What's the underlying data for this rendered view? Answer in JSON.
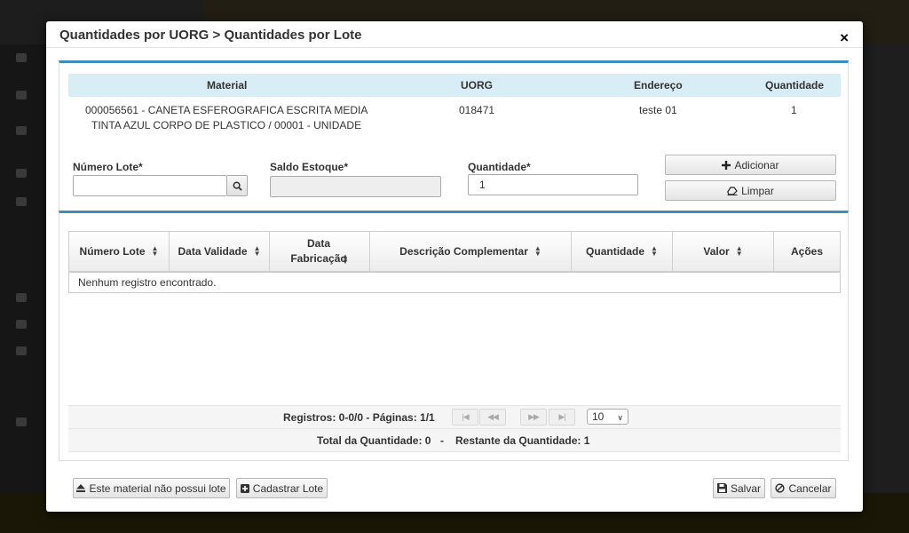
{
  "modal": {
    "title": "Quantidades por UORG > Quantidades por Lote",
    "close_label": "×"
  },
  "material_table": {
    "headers": [
      "Material",
      "UORG",
      "Endereço",
      "Quantidade"
    ],
    "row": {
      "material_line1": "000056561 - CANETA ESFEROGRAFICA ESCRITA MEDIA",
      "material_line2": "TINTA AZUL CORPO DE PLASTICO / 00001 - UNIDADE",
      "uorg": "018471",
      "endereco": "teste 01",
      "quantidade": "1"
    }
  },
  "form": {
    "numero_lote_label": "Número Lote*",
    "numero_lote_value": "",
    "saldo_estoque_label": "Saldo Estoque*",
    "saldo_estoque_value": "",
    "quantidade_label": "Quantidade*",
    "quantidade_value": "1",
    "adicionar_label": "Adicionar",
    "limpar_label": "Limpar"
  },
  "lotes_table": {
    "headers": [
      "Número Lote",
      "Data Validade",
      "Data Fabricação",
      "Descrição Complementar",
      "Quantidade",
      "Valor",
      "Ações"
    ],
    "empty_message": "Nenhum registro encontrado."
  },
  "pagination": {
    "summary": "Registros: 0-0/0 - Páginas: 1/1",
    "page_size": "10"
  },
  "totals": {
    "total": "Total da Quantidade: 0",
    "separator": "-",
    "restante": "Restante da Quantidade: 1"
  },
  "footer": {
    "sem_lote_label": "Este material não possui lote",
    "cadastrar_lote_label": "Cadastrar Lote",
    "salvar_label": "Salvar",
    "cancelar_label": "Cancelar"
  },
  "colors": {
    "accent": "#3c8dbc",
    "table_header_bg": "#d9edf7"
  }
}
